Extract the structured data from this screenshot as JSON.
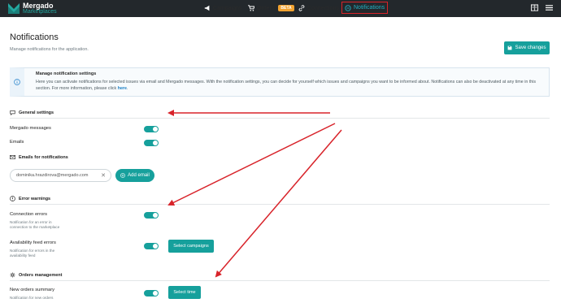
{
  "brand": {
    "name": "Mergado",
    "sub": "Marketplaces",
    "accent": "#16a09c"
  },
  "nav": {
    "campaigns": "Campaigns",
    "orders": "Orders",
    "orders_badge": "BETA",
    "connections": "Connections",
    "notifications": "Notifications"
  },
  "header": {
    "title": "Notifications",
    "subtitle": "Manage notifications for the application.",
    "save_label": "Save changes"
  },
  "info": {
    "title": "Manage notification settings",
    "text": "Here you can activate notifications for selected issues via email and Mergado messages. With the notification settings, you can decide for yourself which issues and campaigns you want to be informed about. Notifications can also be deactivated at any time in this section. For more information, please click",
    "link": "here",
    "end": "."
  },
  "general": {
    "title": "General settings",
    "mergado_messages": "Mergado messages",
    "mergado_messages_on": true,
    "emails": "Emails",
    "emails_on": true
  },
  "emails_section": {
    "title": "Emails for notifications",
    "email_value": "dominika.hrazdirova@mergado.com",
    "add_label": "Add email"
  },
  "errors": {
    "title": "Error warnings",
    "connection_label": "Connection errors",
    "connection_desc": "Notification for an error in connection to the marketplace",
    "connection_on": true,
    "feed_label": "Availability feed errors",
    "feed_desc": "Notification for errors in the availability feed",
    "feed_on": true,
    "select_campaigns": "Select campaigns"
  },
  "orders": {
    "title": "Orders management",
    "summary_label": "New orders summary",
    "summary_desc": "Notification for new orders",
    "summary_on": true,
    "select_time": "Select time"
  }
}
